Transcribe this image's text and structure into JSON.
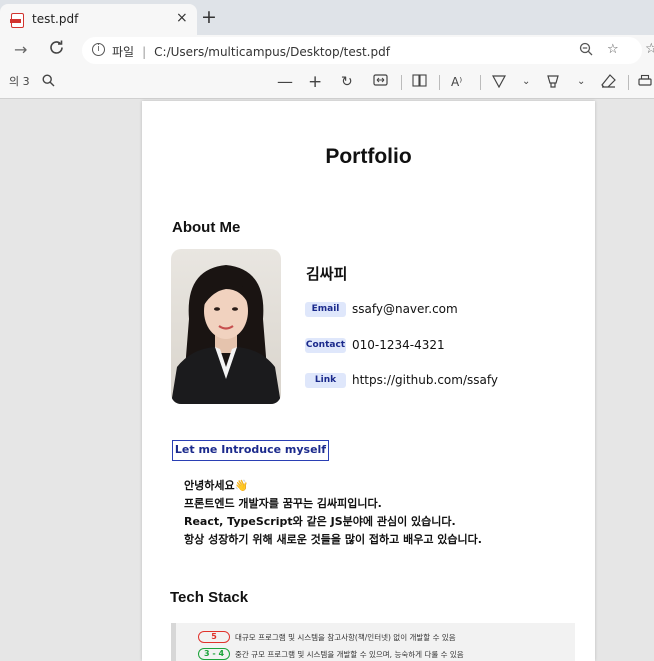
{
  "browser": {
    "tab_title": "test.pdf",
    "tab_close": "×",
    "new_tab": "+",
    "scheme_label": "파일",
    "url": "C:/Users/multicampus/Desktop/test.pdf"
  },
  "pdf_toolbar": {
    "page_of": "의 3"
  },
  "document": {
    "title": "Portfolio",
    "about_heading": "About Me",
    "name": "김싸피",
    "contacts": [
      {
        "label": "Email",
        "value": "ssafy@naver.com"
      },
      {
        "label": "Contact",
        "value": "010-1234-4321"
      },
      {
        "label": "Link",
        "value": "https://github.com/ssafy"
      }
    ],
    "intro_button": "Let me Introduce myself",
    "intro_lines": [
      "안녕하세요👋",
      "프론트엔드 개발자를 꿈꾸는 김싸피입니다.",
      "React, TypeScript와 같은 JS분야에 관심이 있습니다.",
      "항상 성장하기 위해 새로운 것들을 많이 접하고 배우고 있습니다."
    ],
    "tech_heading": "Tech Stack",
    "skill_levels": [
      {
        "level": "5",
        "desc": "대규모 프로그램 및 시스템을 참고사항(책/인터넷) 없이 개발할 수 있음",
        "color": "#e0322b"
      },
      {
        "level": "3 - 4",
        "desc": "중간 규모 프로그램 및 시스템을 개발할 수 있으며, 능숙하게 다룰 수 있음",
        "color": "#1ca33a"
      }
    ]
  },
  "colors": {
    "accent": "#2a3fb4",
    "badge_bg": "#dfe7fb"
  }
}
